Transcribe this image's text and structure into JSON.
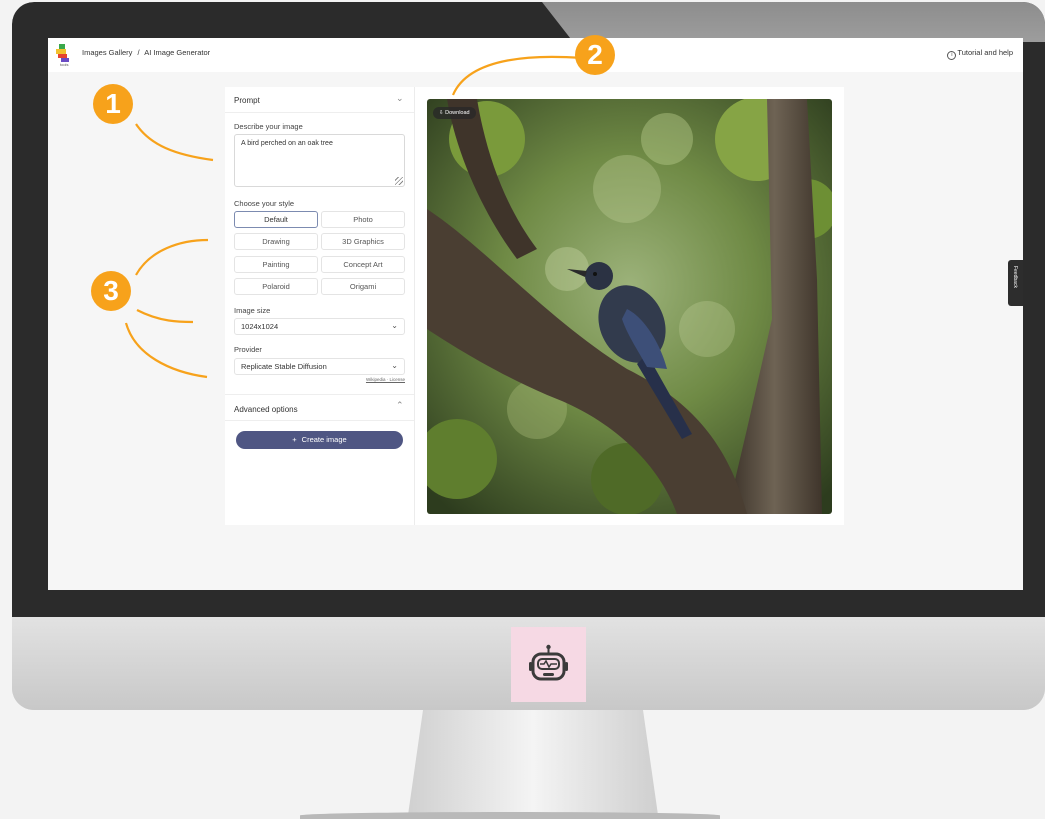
{
  "breadcrumb": {
    "gallery": "Images Gallery",
    "separator": "/",
    "current": "AI Image Generator"
  },
  "app_logo_text": "tools",
  "help": {
    "label": "Tutorial and help",
    "icon": "info-icon"
  },
  "prompt_section": {
    "title": "Prompt",
    "describe_label": "Describe your image",
    "prompt_value": "A bird perched on an oak tree",
    "style_label": "Choose your style",
    "styles": [
      "Default",
      "Photo",
      "Drawing",
      "3D Graphics",
      "Painting",
      "Concept Art",
      "Polaroid",
      "Origami"
    ],
    "selected_style": "Default",
    "image_size_label": "Image size",
    "image_size_value": "1024x1024",
    "provider_label": "Provider",
    "provider_value": "Replicate Stable Diffusion",
    "provider_links": "Wikipedia · License"
  },
  "advanced": {
    "title": "Advanced options"
  },
  "create_button": {
    "icon": "+",
    "label": "Create image"
  },
  "image": {
    "download_label": "Download",
    "download_icon": "download-icon"
  },
  "feedback": {
    "label": "Feedback"
  },
  "annotations": {
    "badge1": "1",
    "badge2": "2",
    "badge3": "3",
    "color": "#f7a21b"
  },
  "chin_icon": "robot-icon",
  "colors": {
    "accent": "#4f5683",
    "badge": "#f7a21b"
  }
}
